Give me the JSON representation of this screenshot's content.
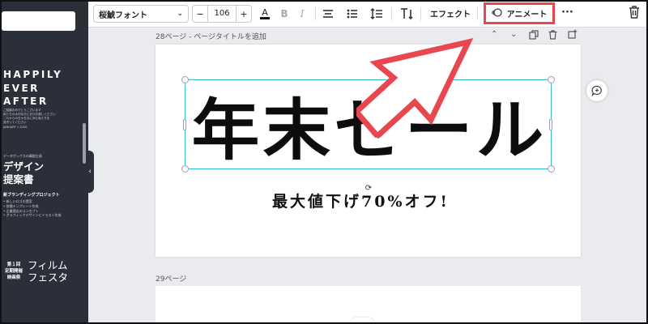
{
  "sidebar": {
    "template1": {
      "title_lines": [
        "HAPPILY",
        "EVER",
        "AFTER"
      ],
      "body_lines": [
        "ご結婚おめでとうございます",
        "私たちの大切な日にぜひお越しください",
        "これからの日々を共に歩む私たちを",
        "見守ってください",
        "JANUARY 1 2020"
      ]
    },
    "template2": {
      "kicker": "データポックスの精鋭企画",
      "title_lines": [
        "デザイン",
        "提案書"
      ],
      "subtitle": "新ブランディングプロジェクト",
      "bullets": [
        "新しいロゴの提案",
        "各種テンプレート作成",
        "企業理念のコンセプト",
        "グラフィックデザインとイラスト作成"
      ]
    },
    "template3": {
      "left_lines": [
        "第１回",
        "定期開催",
        "映画祭"
      ],
      "right_lines": [
        "フィルム",
        "フェスタ"
      ]
    }
  },
  "toolbar": {
    "font_name": "桜鯱フォント",
    "font_size": "106",
    "minus": "−",
    "plus": "+",
    "effect_label": "エフェクト",
    "animate_label": "アニメート",
    "more": "···",
    "colors": {
      "text_color_bar": "#111111",
      "highlight": "#e8474f"
    }
  },
  "pages": {
    "page28_label": "28ページ - ページタイトルを追加",
    "page29_label": "29ページ"
  },
  "canvas": {
    "headline": "年末セール",
    "subline": "最大値下げ70%オフ!"
  },
  "accent_colors": {
    "selection": "#2ec0c8",
    "arrow": "#e8474f",
    "sidebar_bg": "#2a2f3a"
  }
}
